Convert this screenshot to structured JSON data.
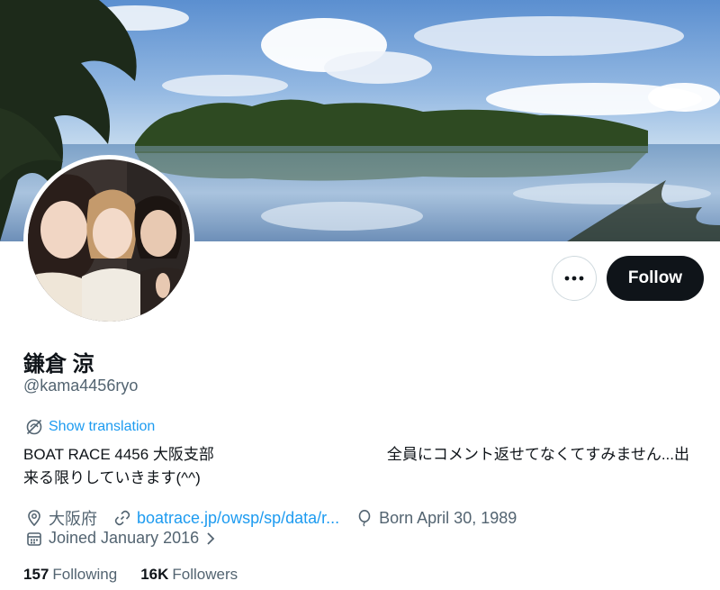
{
  "header": {
    "banner_icon": "tropical-island-photo",
    "avatar_icon": "three-women-selfie-photo"
  },
  "actions": {
    "more_icon": "more-dots-icon",
    "follow_label": "Follow"
  },
  "profile": {
    "display_name": "鎌倉 涼",
    "handle": "@kama4456ryo",
    "show_translation": "Show translation",
    "bio_part1": "BOAT RACE 4456 大阪支部",
    "bio_part2": "全員にコメント返せてなくてすみません...出",
    "bio_line2": "来る限りしていきます(^^)"
  },
  "meta": {
    "location": "大阪府",
    "website": "boatrace.jp/owsp/sp/data/r...",
    "birthday": "Born April 30, 1989",
    "joined": "Joined January 2016"
  },
  "stats": {
    "following_count": "157",
    "following_label": "Following",
    "followers_count": "16K",
    "followers_label": "Followers"
  },
  "colors": {
    "accent": "#1d9bf0",
    "follow_button": "#0f1419",
    "secondary_text": "#536471"
  }
}
